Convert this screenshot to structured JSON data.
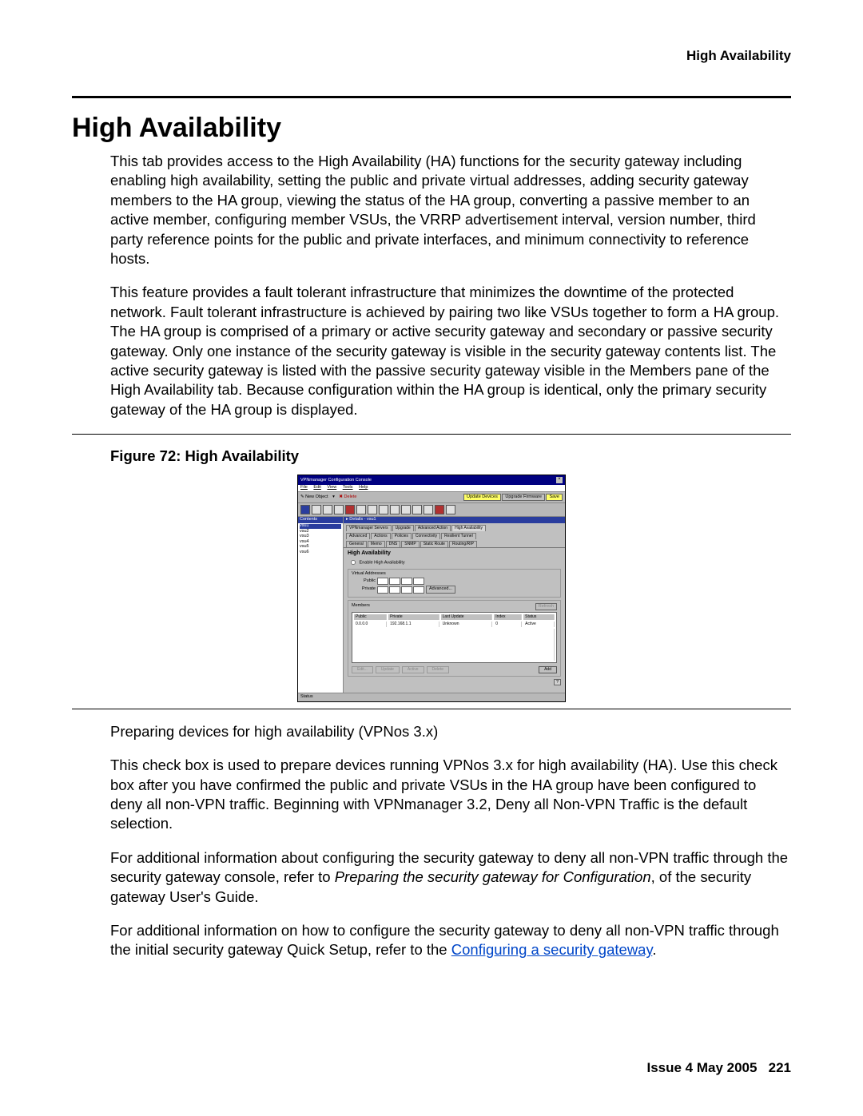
{
  "header": {
    "right": "High Availability"
  },
  "title": "High Availability",
  "para1": "This tab provides access to the High Availability (HA) functions for the security gateway including enabling high availability, setting the public and private virtual addresses, adding security gateway members to the HA group, viewing the status of the HA group, converting a passive member to an active member, configuring member VSUs, the VRRP advertisement interval, version number, third party reference points for the public and private interfaces, and minimum connectivity to reference hosts.",
  "para2": "This feature provides a fault tolerant infrastructure that minimizes the downtime of the protected network. Fault tolerant infrastructure is achieved by pairing two like VSUs together to form a HA group. The HA group is comprised of a primary or active security gateway and secondary or passive security gateway. Only one instance of the security gateway is visible in the security gateway contents list. The active security gateway is listed with the passive security gateway visible in the Members pane of the High Availability tab. Because configuration within the HA group is identical, only the primary security gateway of the HA group is displayed.",
  "figure_caption": "Figure 72: High Availability",
  "para3": "Preparing devices for high availability (VPNos 3.x)",
  "para4": "This check box is used to prepare devices running VPNos 3.x for high availability (HA). Use this check box after you have confirmed the public and private VSUs in the HA group have been configured to deny all non-VPN traffic. Beginning with VPNmanager 3.2, Deny all Non-VPN Traffic is the default selection.",
  "para5_a": "For additional information about configuring the security gateway to deny all non-VPN traffic through the security gateway console, refer to ",
  "para5_i": "Preparing the security gateway for Configuration",
  "para5_b": ", of the security gateway User's Guide.",
  "para6_a": "For additional information on how to configure the security gateway to deny all non-VPN traffic through the initial security gateway Quick Setup, refer to the ",
  "para6_link": "Configuring a security gateway",
  "para6_b": ".",
  "footer": {
    "issue": "Issue 4   May 2005",
    "page": "221"
  },
  "console": {
    "title": "VPNmanager Configuration Console",
    "menu": [
      "File",
      "Edit",
      "View",
      "Tools",
      "Help"
    ],
    "toolbar": {
      "newobj": "New Object",
      "delete": "Delete",
      "btn1": "Update Devices",
      "btn2": "Upgrade Firmware",
      "btn3": "Save"
    },
    "sidebar": {
      "header": "Contents",
      "items": [
        "vsu1",
        "vsu2",
        "vsu3",
        "vsu4",
        "vsu5",
        "vsu6"
      ]
    },
    "crumb": "Details - vsu1",
    "tabs_row1": [
      "VPNmanager Servers",
      "Upgrade",
      "Advanced Action",
      "High Availability"
    ],
    "tabs_row2": [
      "Advanced",
      "Actions",
      "Policies",
      "Connectivity",
      "Resilient Tunnel"
    ],
    "tabs_row3": [
      "General",
      "Memo",
      "DNS",
      "SNMP",
      "Static Route",
      "Routing/RIP"
    ],
    "panel": {
      "title": "High Availability",
      "chk": "Enable High Availability",
      "va_legend": "Virtual Addresses",
      "lbl_public": "Public",
      "lbl_private": "Private",
      "btn_advanced": "Advanced...",
      "members_legend": "Members",
      "btn_refresh": "Refresh",
      "columns": [
        "Public",
        "Private",
        "Last Update",
        "Index",
        "Status"
      ],
      "row": [
        "0.0.0.0",
        "192.168.1.1",
        "Unknown",
        "0",
        "Active"
      ],
      "btns": {
        "edit": "Edit...",
        "update": "Update",
        "active": "Active",
        "delete": "Delete",
        "add": "Add"
      }
    },
    "status": "Status"
  }
}
